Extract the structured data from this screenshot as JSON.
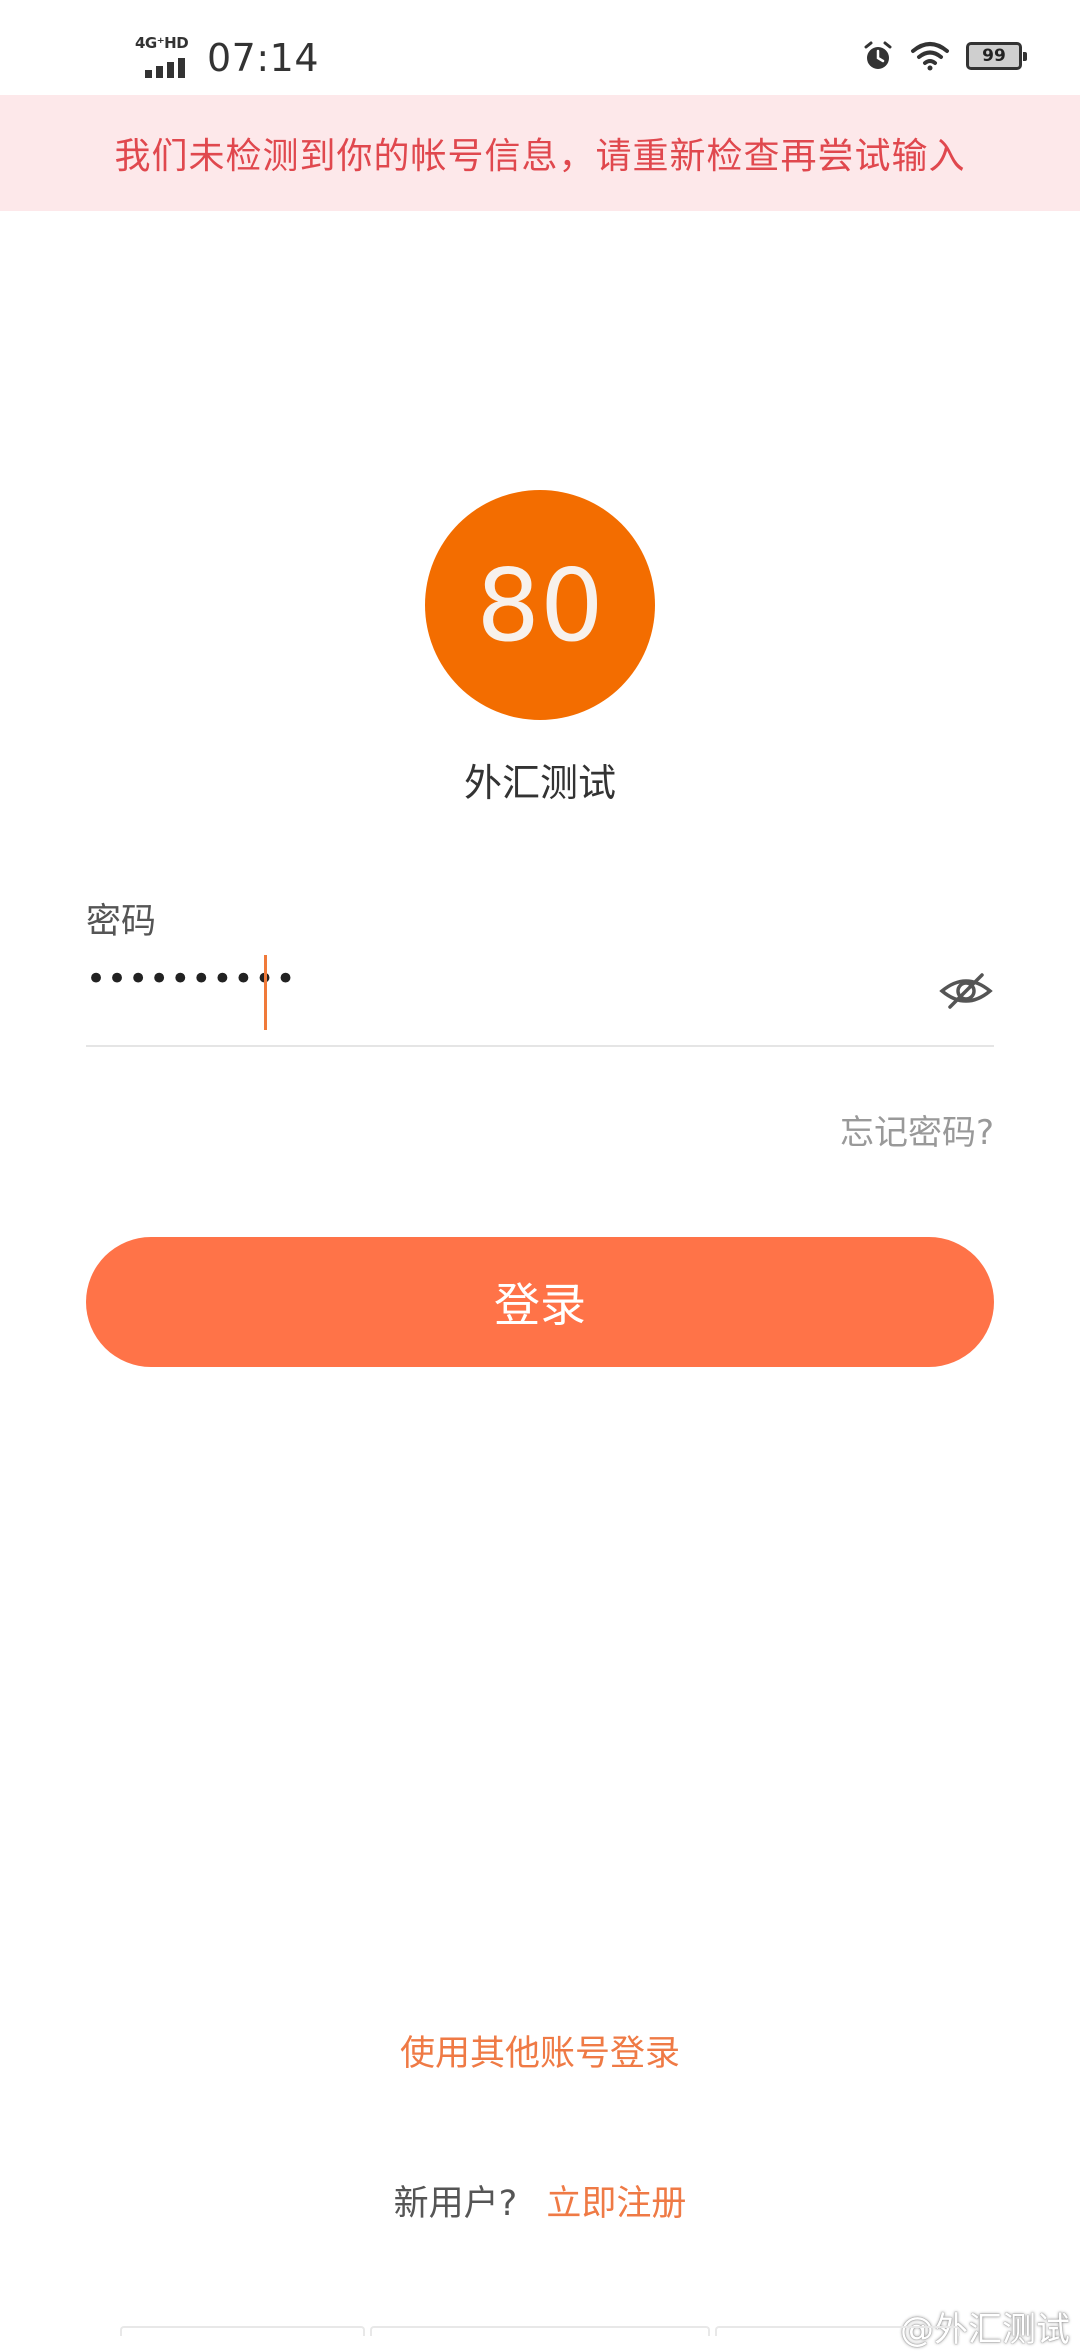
{
  "status_bar": {
    "network": "4G⁺HD",
    "time": "07:14",
    "battery": "99",
    "icons": [
      "signal-icon",
      "alarm-icon",
      "wifi-icon",
      "battery-icon"
    ]
  },
  "error_banner": {
    "message": "我们未检测到你的帐号信息，请重新检查再尝试输入"
  },
  "account": {
    "avatar_text": "80",
    "name": "外汇测试"
  },
  "password": {
    "label": "密码",
    "masked_value": "••••••••••",
    "toggle_icon": "eye-hidden-icon"
  },
  "forgot_password": "忘记密码?",
  "login_button": "登录",
  "other_account_link": "使用其他账号登录",
  "register": {
    "question": "新用户?",
    "link": "立即注册"
  },
  "watermark": "@外汇测试",
  "colors": {
    "accent": "#ff7348",
    "avatar": "#f36d00",
    "error_text": "#e0484e",
    "error_bg": "#fde8ea",
    "link": "#ef7a45"
  }
}
